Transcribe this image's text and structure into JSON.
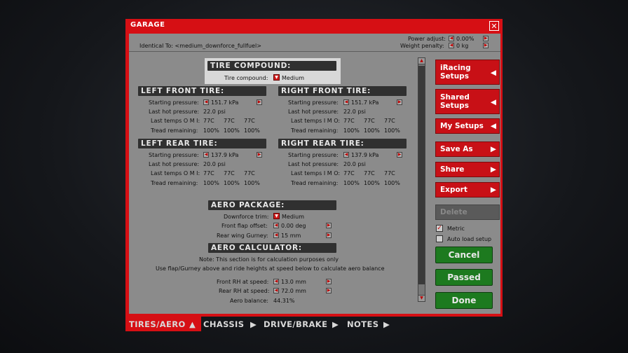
{
  "title": "GARAGE",
  "close_label": "✕",
  "identical_to": "Identical To: <medium_downforce_fullfuel>",
  "power_adjust": {
    "label": "Power adjust:",
    "value": "0.00%"
  },
  "weight_penalty": {
    "label": "Weight penalty:",
    "value": "0 kg"
  },
  "tire_compound": {
    "header": "TIRE COMPOUND:",
    "label": "Tire compound:",
    "value": "Medium"
  },
  "labels": {
    "starting_pressure": "Starting pressure:",
    "last_hot_pressure": "Last hot pressure:",
    "last_temps_omi": "Last temps O M I:",
    "last_temps_imo": "Last temps I M O:",
    "tread_remaining": "Tread remaining:"
  },
  "lf": {
    "header": "LEFT FRONT TIRE:",
    "start": "151.7 kPa",
    "hot": "22.0 psi",
    "temps": [
      "77C",
      "77C",
      "77C"
    ],
    "tread": [
      "100%",
      "100%",
      "100%"
    ]
  },
  "rf": {
    "header": "RIGHT FRONT TIRE:",
    "start": "151.7 kPa",
    "hot": "22.0 psi",
    "temps": [
      "77C",
      "77C",
      "77C"
    ],
    "tread": [
      "100%",
      "100%",
      "100%"
    ]
  },
  "lr": {
    "header": "LEFT REAR TIRE:",
    "start": "137.9 kPa",
    "hot": "20.0 psi",
    "temps": [
      "77C",
      "77C",
      "77C"
    ],
    "tread": [
      "100%",
      "100%",
      "100%"
    ]
  },
  "rr": {
    "header": "RIGHT REAR TIRE:",
    "start": "137.9 kPa",
    "hot": "20.0 psi",
    "temps": [
      "77C",
      "77C",
      "77C"
    ],
    "tread": [
      "100%",
      "100%",
      "100%"
    ]
  },
  "aero": {
    "header": "AERO PACKAGE:",
    "downforce_label": "Downforce trim:",
    "downforce_value": "Medium",
    "flap_label": "Front flap offset:",
    "flap_value": "0.00 deg",
    "gurney_label": "Rear wing Gurney:",
    "gurney_value": "15 mm"
  },
  "calc": {
    "header": "AERO CALCULATOR:",
    "note1": "Note: This section is for calculation purposes only",
    "note2": "Use flap/Gurney above and ride heights at speed below to calculate aero balance",
    "front_label": "Front RH at speed:",
    "front_value": "13.0 mm",
    "rear_label": "Rear RH at speed:",
    "rear_value": "72.0 mm",
    "balance_label": "Aero balance:",
    "balance_value": "44.31%"
  },
  "sidebar": {
    "iracing": [
      "iRacing",
      "Setups"
    ],
    "shared": [
      "Shared",
      "Setups"
    ],
    "my": "My Setups",
    "save_as": "Save As",
    "share": "Share",
    "export": "Export",
    "delete": "Delete",
    "metric": "Metric",
    "auto_load": "Auto load setup"
  },
  "buttons": {
    "cancel": "Cancel",
    "passed": "Passed",
    "done": "Done"
  },
  "tabs": [
    "TIRES/AERO",
    "CHASSIS",
    "DRIVE/BRAKE",
    "NOTES"
  ],
  "colors": {
    "accent": "#d60f14",
    "panel": "#8b8b8b",
    "header": "#303030",
    "green": "#1d7a1f"
  }
}
